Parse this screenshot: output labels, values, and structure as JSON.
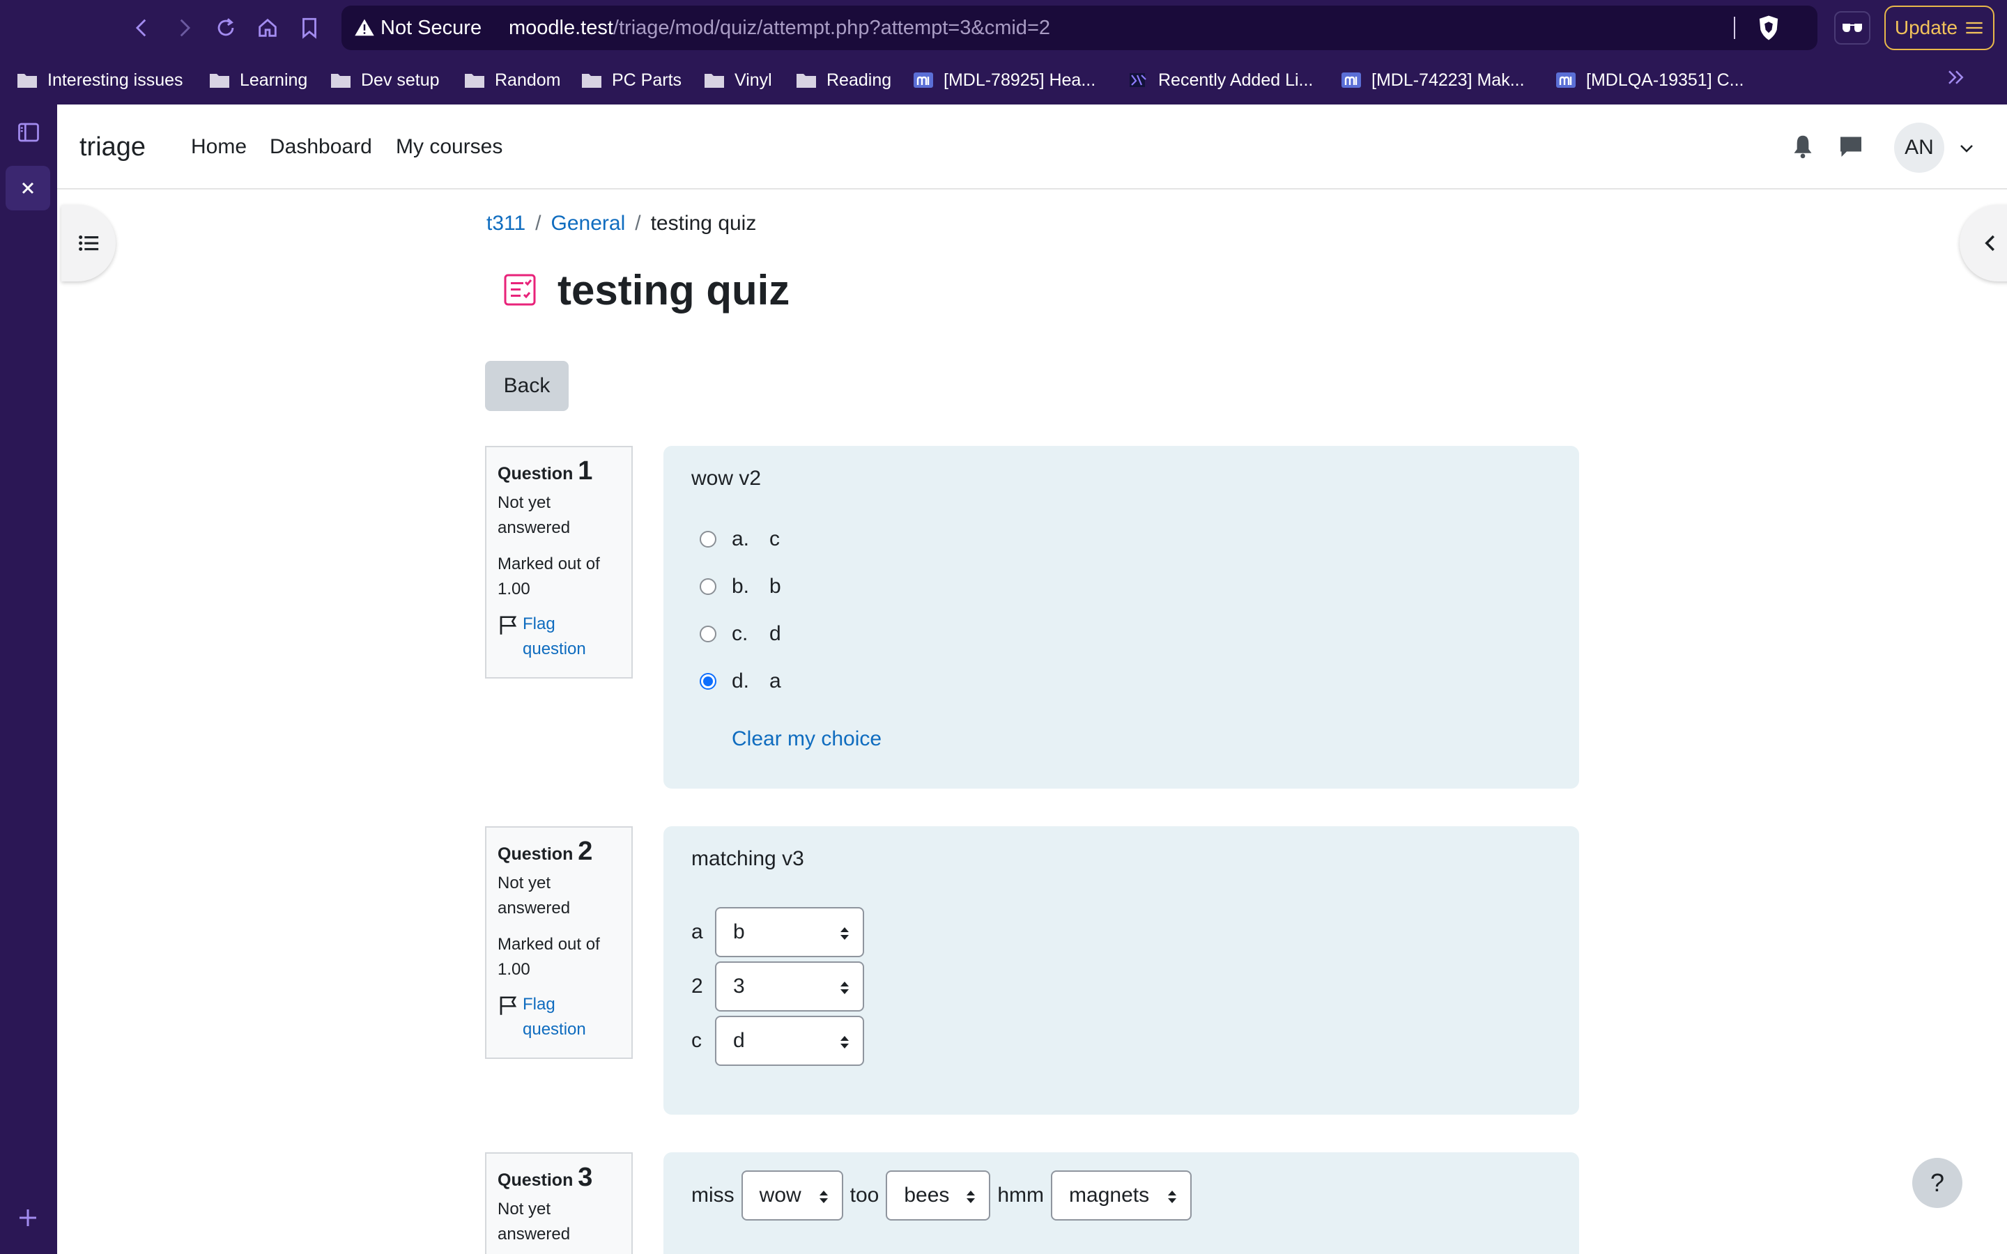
{
  "browser": {
    "security_label": "Not Secure",
    "url_host": "moodle.test",
    "url_path": "/triage/mod/quiz/attempt.php?attempt=3&cmid=2",
    "update_label": "Update",
    "bookmarks": [
      {
        "label": "Interesting issues",
        "icon": "folder-icon"
      },
      {
        "label": "Learning",
        "icon": "folder-icon"
      },
      {
        "label": "Dev setup",
        "icon": "folder-icon"
      },
      {
        "label": "Random",
        "icon": "folder-icon"
      },
      {
        "label": "PC Parts",
        "icon": "folder-icon"
      },
      {
        "label": "Vinyl",
        "icon": "folder-icon"
      },
      {
        "label": "Reading",
        "icon": "folder-icon"
      },
      {
        "label": "[MDL-78925] Hea...",
        "icon": "moodle-tracker-icon"
      },
      {
        "label": "Recently Added Li...",
        "icon": "site-icon"
      },
      {
        "label": "[MDL-74223] Mak...",
        "icon": "moodle-tracker-icon"
      },
      {
        "label": "[MDLQA-19351] C...",
        "icon": "moodle-tracker-icon"
      }
    ]
  },
  "site": {
    "brand": "triage",
    "nav": [
      "Home",
      "Dashboard",
      "My courses"
    ],
    "user_initials": "AN"
  },
  "breadcrumb": {
    "items": [
      "t311",
      "General"
    ],
    "current": "testing quiz"
  },
  "page": {
    "title": "testing quiz",
    "back_label": "Back",
    "help_label": "?"
  },
  "questions": [
    {
      "label": "Question",
      "number": "1",
      "state": "Not yet answered",
      "grade": "Marked out of 1.00",
      "flag_label": "Flag question",
      "text": "wow v2",
      "options": [
        {
          "letter": "a.",
          "text": "c",
          "checked": false
        },
        {
          "letter": "b.",
          "text": "b",
          "checked": false
        },
        {
          "letter": "c.",
          "text": "d",
          "checked": false
        },
        {
          "letter": "d.",
          "text": "a",
          "checked": true
        }
      ],
      "clear_label": "Clear my choice"
    },
    {
      "label": "Question",
      "number": "2",
      "state": "Not yet answered",
      "grade": "Marked out of 1.00",
      "flag_label": "Flag question",
      "text": "matching v3",
      "rows": [
        {
          "stem": "a",
          "selected": "b"
        },
        {
          "stem": "2",
          "selected": "3"
        },
        {
          "stem": "c",
          "selected": "d"
        }
      ]
    },
    {
      "label": "Question",
      "number": "3",
      "state": "Not yet answered",
      "parts": [
        {
          "text": "miss",
          "selected": "wow"
        },
        {
          "text": "too",
          "selected": "bees"
        },
        {
          "text": "hmm",
          "selected": "magnets"
        }
      ]
    }
  ],
  "colors": {
    "browser_bg": "#2b1755",
    "link": "#0f6cbf",
    "question_bg": "#e7f1f5",
    "quiz_icon": "#e8237a",
    "radio_checked": "#0d6efd"
  }
}
